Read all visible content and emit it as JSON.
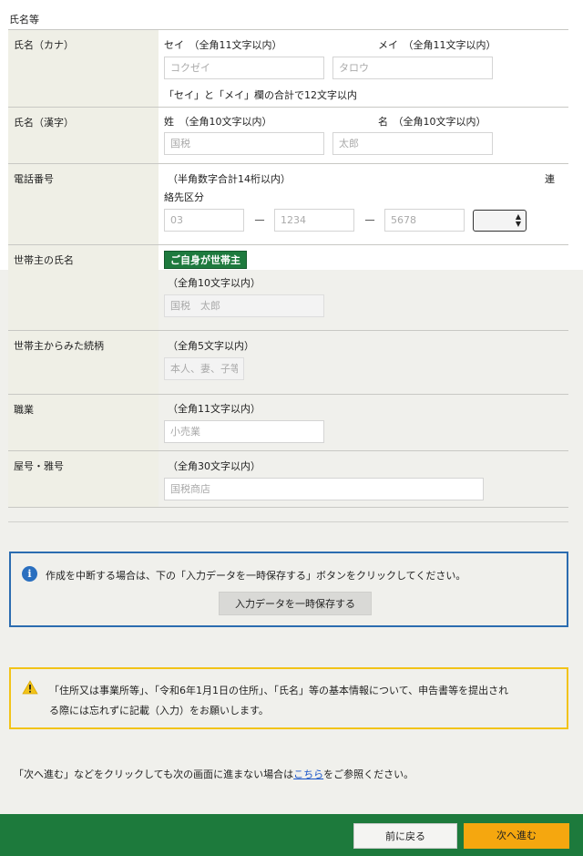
{
  "section_title": "氏名等",
  "kana": {
    "label": "氏名（カナ）",
    "sei_label": "セイ　（全角11文字以内）",
    "mei_label": "メイ　（全角11文字以内）",
    "sei_placeholder": "コクゼイ",
    "mei_placeholder": "タロウ",
    "note": "「セイ」と「メイ」欄の合計で12文字以内"
  },
  "kanji": {
    "label": "氏名（漢字）",
    "sei_label": "姓　（全角10文字以内）",
    "mei_label": "名　（全角10文字以内）",
    "sei_placeholder": "国税",
    "mei_placeholder": "太郎"
  },
  "phone": {
    "label": "電話番号",
    "hint": "（半角数字合計14桁以内）",
    "contact_label_1": "連",
    "contact_label_2": "絡先区分",
    "part1_placeholder": "03",
    "part2_placeholder": "1234",
    "part3_placeholder": "5678",
    "dash": "－"
  },
  "householder_name": {
    "label": "世帯主の氏名",
    "button": "ご自身が世帯主",
    "hint": "（全角10文字以内）",
    "placeholder": "国税　太郎"
  },
  "relationship": {
    "label": "世帯主からみた続柄",
    "hint": "（全角5文字以内）",
    "placeholder": "本人、妻、子等"
  },
  "occupation": {
    "label": "職業",
    "hint": "（全角11文字以内）",
    "placeholder": "小売業"
  },
  "trade_name": {
    "label": "屋号・雅号",
    "hint": "（全角30文字以内）",
    "placeholder": "国税商店"
  },
  "info": {
    "icon": "info-icon",
    "text": "作成を中断する場合は、下の「入力データを一時保存する」ボタンをクリックしてください。",
    "save_button": "入力データを一時保存する"
  },
  "warning": {
    "icon": "warning-icon",
    "line1": "「住所又は事業所等」、「令和6年1月1日の住所」、「氏名」等の基本情報について、申告書等を提出され",
    "line2": "る際には忘れずに記載（入力）をお願いします。"
  },
  "note": {
    "before": "「次へ進む」などをクリックしても次の画面に進まない場合は",
    "link": "こちら",
    "after": "をご参照ください。"
  },
  "footer": {
    "back_button": "前に戻る",
    "next_button": "次へ進む"
  },
  "colors": {
    "accent_green": "#1d7a3c",
    "next_orange": "#f5a70f",
    "info_blue": "#2b6cb0",
    "warning_yellow": "#f2c318"
  }
}
